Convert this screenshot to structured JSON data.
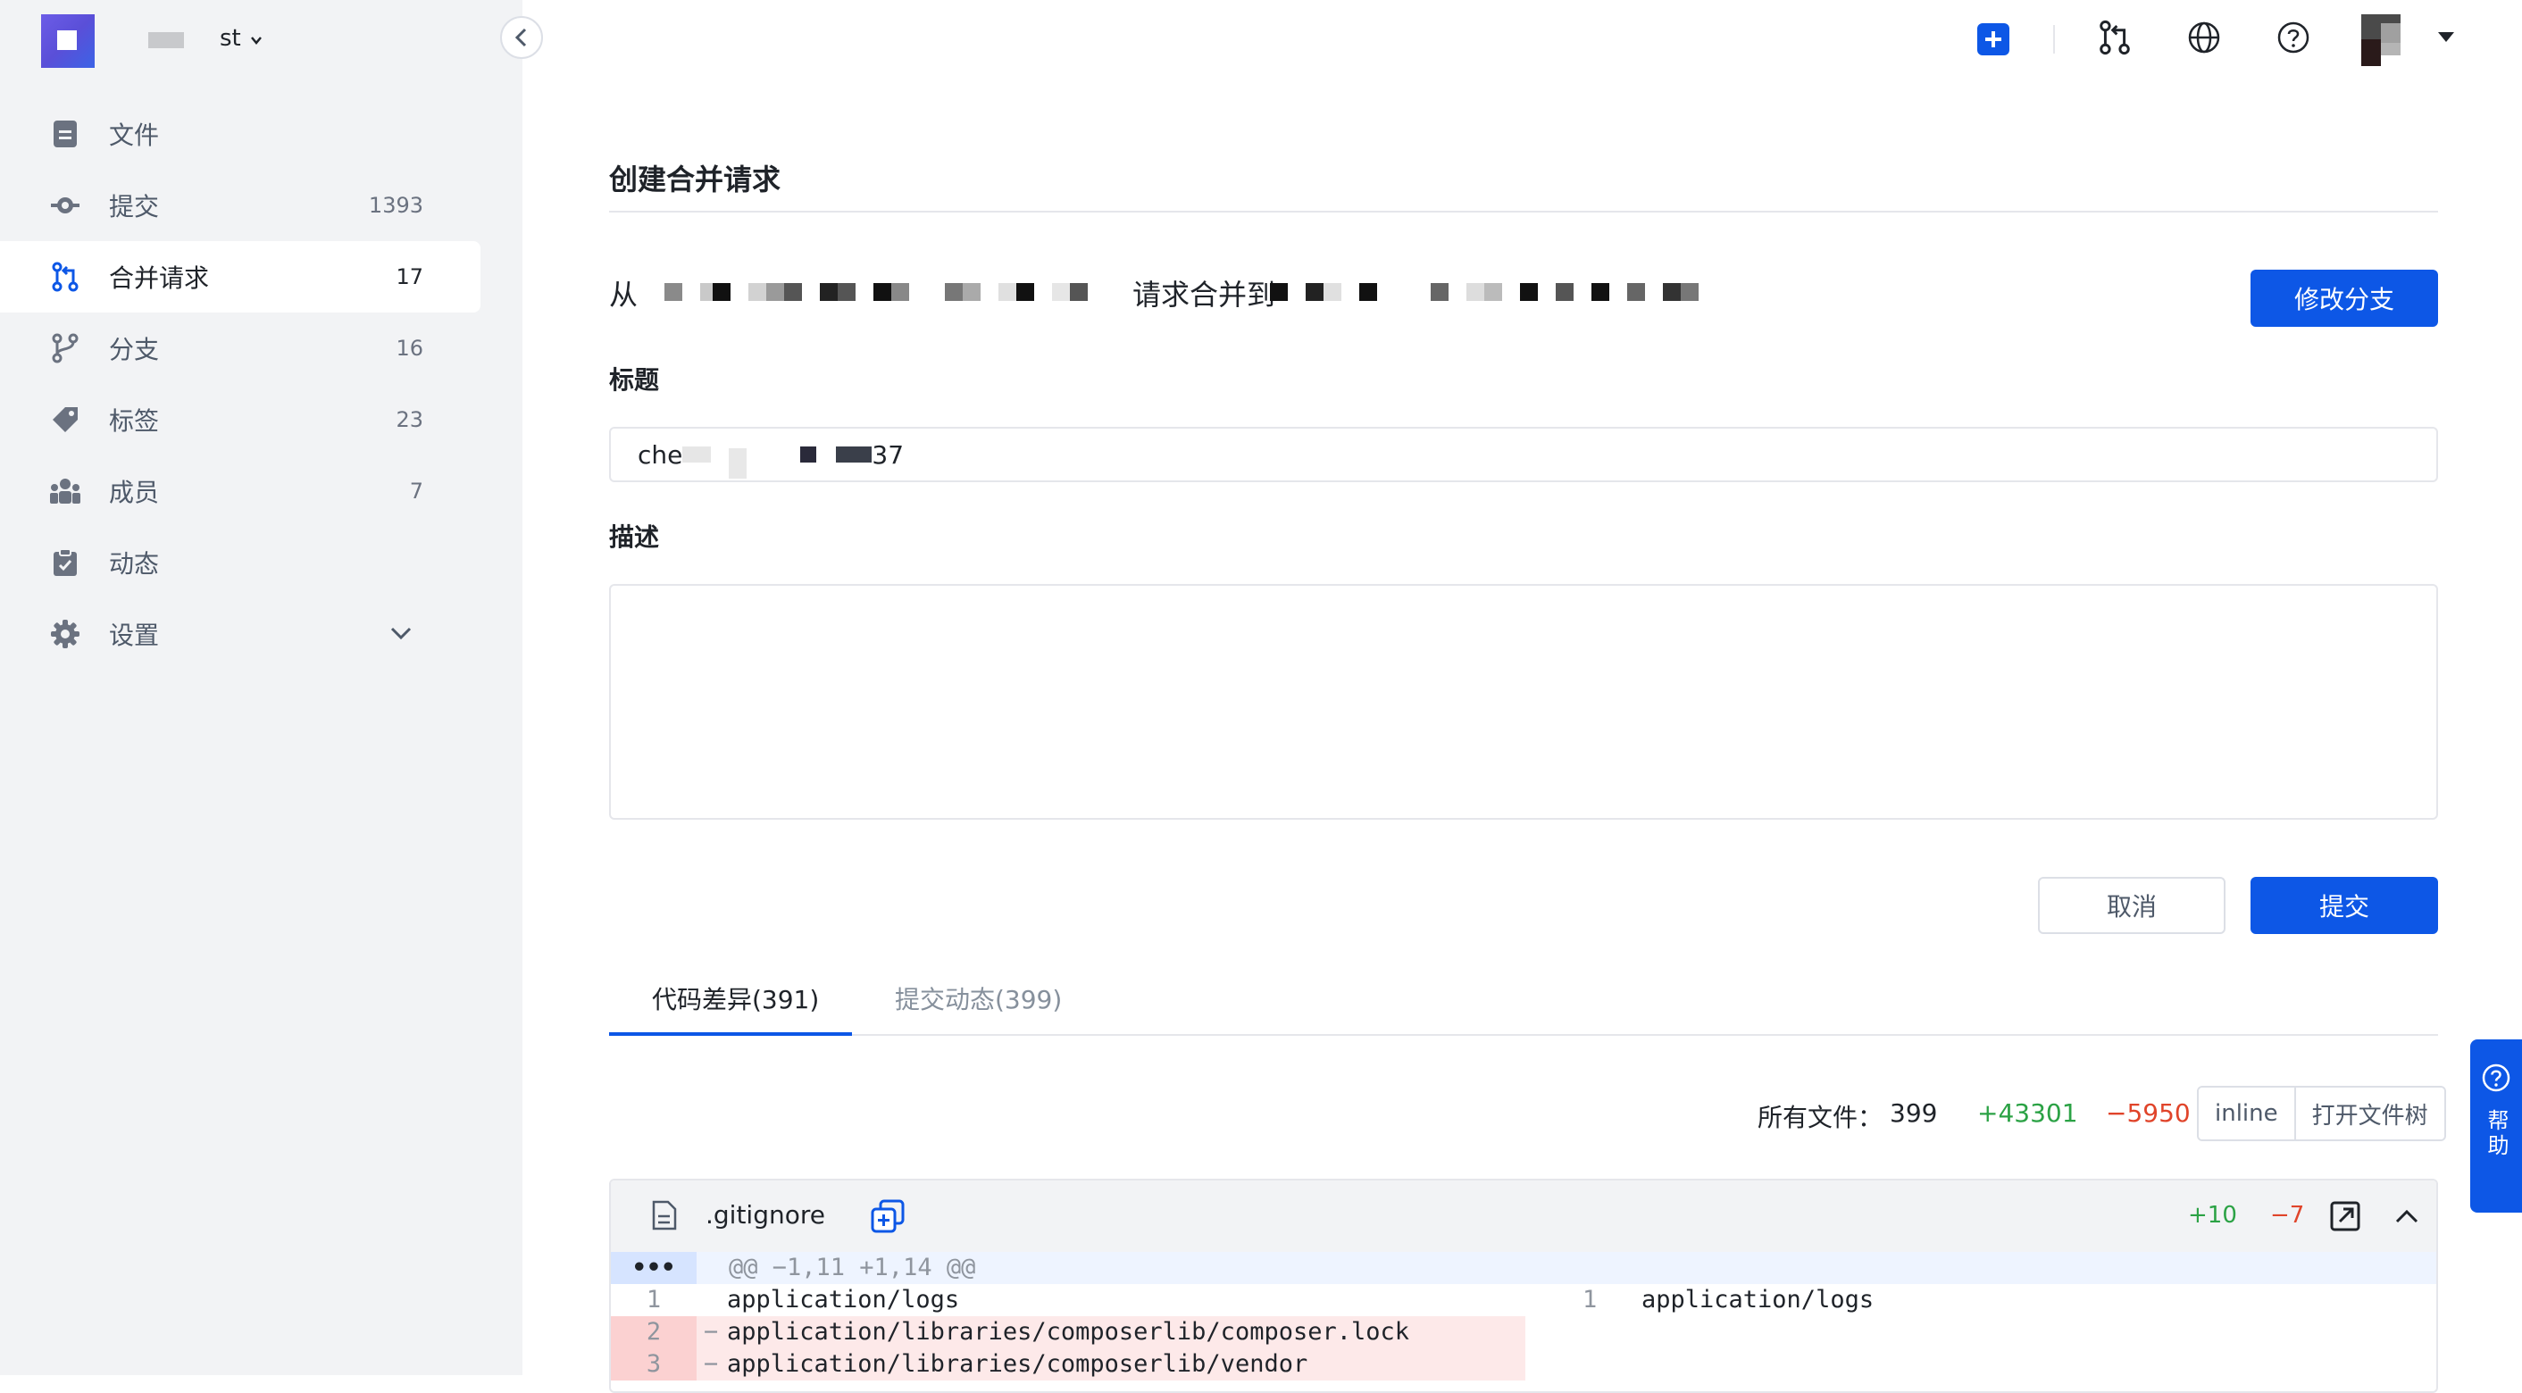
{
  "sidebar": {
    "project_name": "st",
    "items": [
      {
        "label": "文件",
        "count": "",
        "icon": "file-icon"
      },
      {
        "label": "提交",
        "count": "1393",
        "icon": "commit-icon"
      },
      {
        "label": "合并请求",
        "count": "17",
        "icon": "merge-request-icon"
      },
      {
        "label": "分支",
        "count": "16",
        "icon": "branch-icon"
      },
      {
        "label": "标签",
        "count": "23",
        "icon": "tag-icon"
      },
      {
        "label": "成员",
        "count": "7",
        "icon": "members-icon"
      },
      {
        "label": "动态",
        "count": "",
        "icon": "activity-icon"
      },
      {
        "label": "设置",
        "count": "",
        "icon": "gear-icon"
      }
    ],
    "active_index": 2
  },
  "topbar": {
    "icons": [
      "plus-icon",
      "merge-request-icon",
      "globe-icon",
      "help-icon"
    ]
  },
  "page": {
    "title": "创建合并请求",
    "from_label": "从",
    "to_label": "请求合并到",
    "change_branch_button": "修改分支",
    "title_field_label": "标题",
    "title_value_prefix": "che",
    "title_value_suffix": "37",
    "description_label": "描述",
    "cancel_button": "取消",
    "submit_button": "提交"
  },
  "tabs": [
    {
      "label": "代码差异(391)",
      "active": true
    },
    {
      "label": "提交动态(399)",
      "active": false
    }
  ],
  "summary": {
    "all_files_label": "所有文件：",
    "file_count": "399",
    "additions": "+43301",
    "deletions": "−5950",
    "view_mode": "inline",
    "file_tree_button": "打开文件树"
  },
  "diff": {
    "file_name": ".gitignore",
    "additions": "+10",
    "deletions": "−7",
    "hunk_header": "@@ −1,11 +1,14 @@",
    "expand_marker": "•••",
    "lines": [
      {
        "left_num": "1",
        "left_marker": "",
        "left_text": "application/logs",
        "right_num": "1",
        "right_text": "application/logs",
        "deleted": false
      },
      {
        "left_num": "2",
        "left_marker": "−",
        "left_text": "application/libraries/composerlib/composer.lock",
        "right_num": "",
        "right_text": "",
        "deleted": true
      },
      {
        "left_num": "3",
        "left_marker": "−",
        "left_text": "application/libraries/composerlib/vendor",
        "right_num": "",
        "right_text": "",
        "deleted": true
      }
    ]
  },
  "help_float": {
    "label": "帮助"
  },
  "colors": {
    "primary": "#0d57e6",
    "addition": "#2ba245",
    "deletion": "#e0442a",
    "sidebar_bg": "#f2f3f5"
  }
}
